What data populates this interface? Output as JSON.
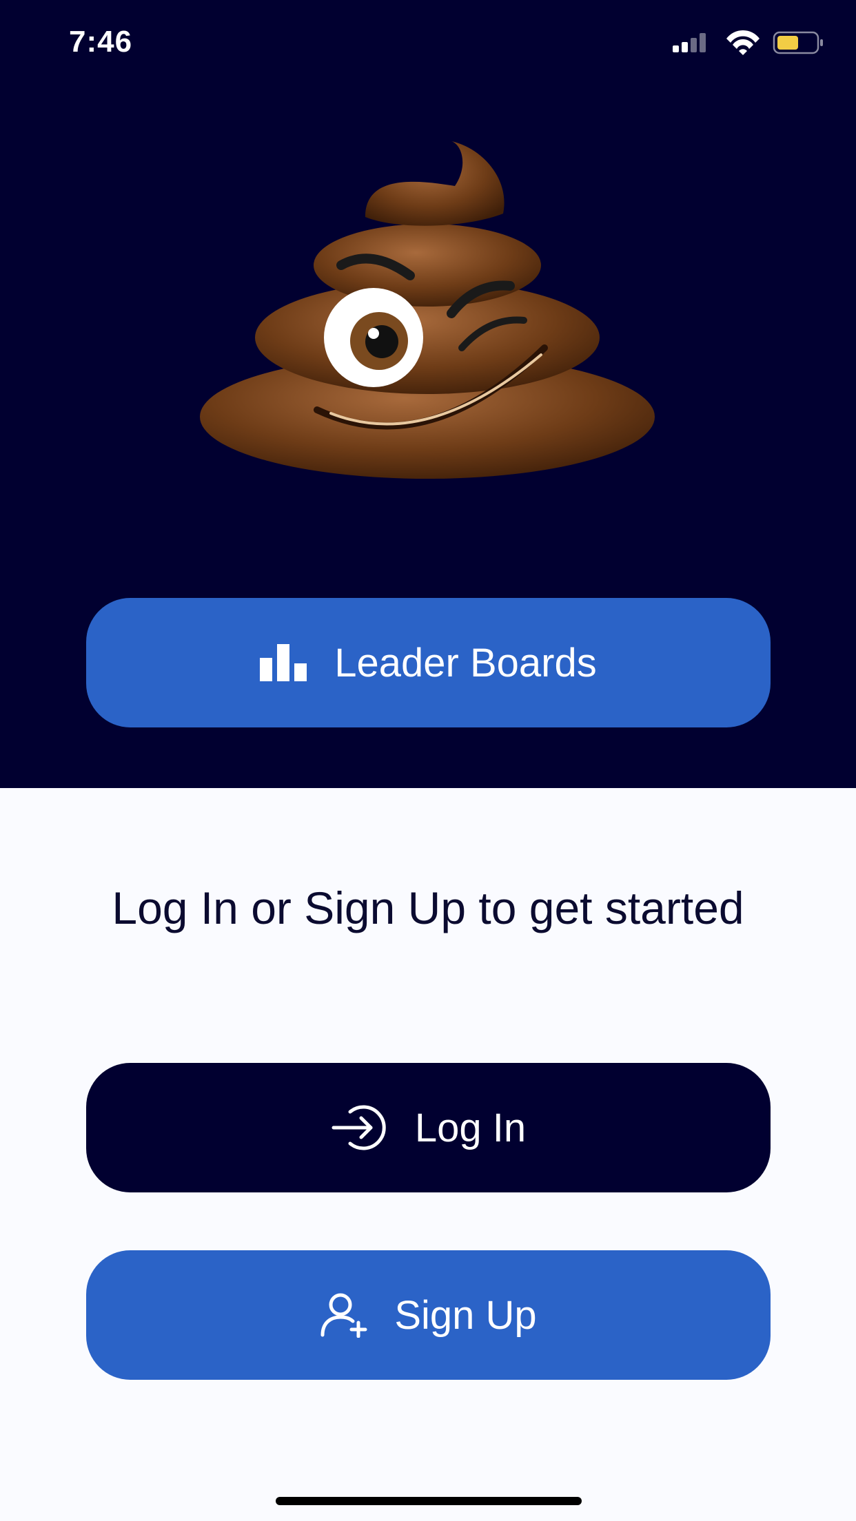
{
  "status_bar": {
    "time": "7:46",
    "icons": [
      "cellular-signal-icon",
      "wifi-icon",
      "battery-icon"
    ],
    "battery_color": "#f2cd45"
  },
  "hero": {
    "background": "#010030",
    "mascot": "winking-poop-emoji"
  },
  "buttons": {
    "leaderboards_label": "Leader Boards",
    "leaderboards_icon": "bar-chart-icon",
    "login_label": "Log In",
    "login_icon": "login-arrow-icon",
    "signup_label": "Sign Up",
    "signup_icon": "add-user-icon"
  },
  "prompt_text": "Log In or Sign Up to get started",
  "colors": {
    "primary_blue": "#2b63c7",
    "navy": "#010030",
    "page_background": "#fafbff"
  }
}
